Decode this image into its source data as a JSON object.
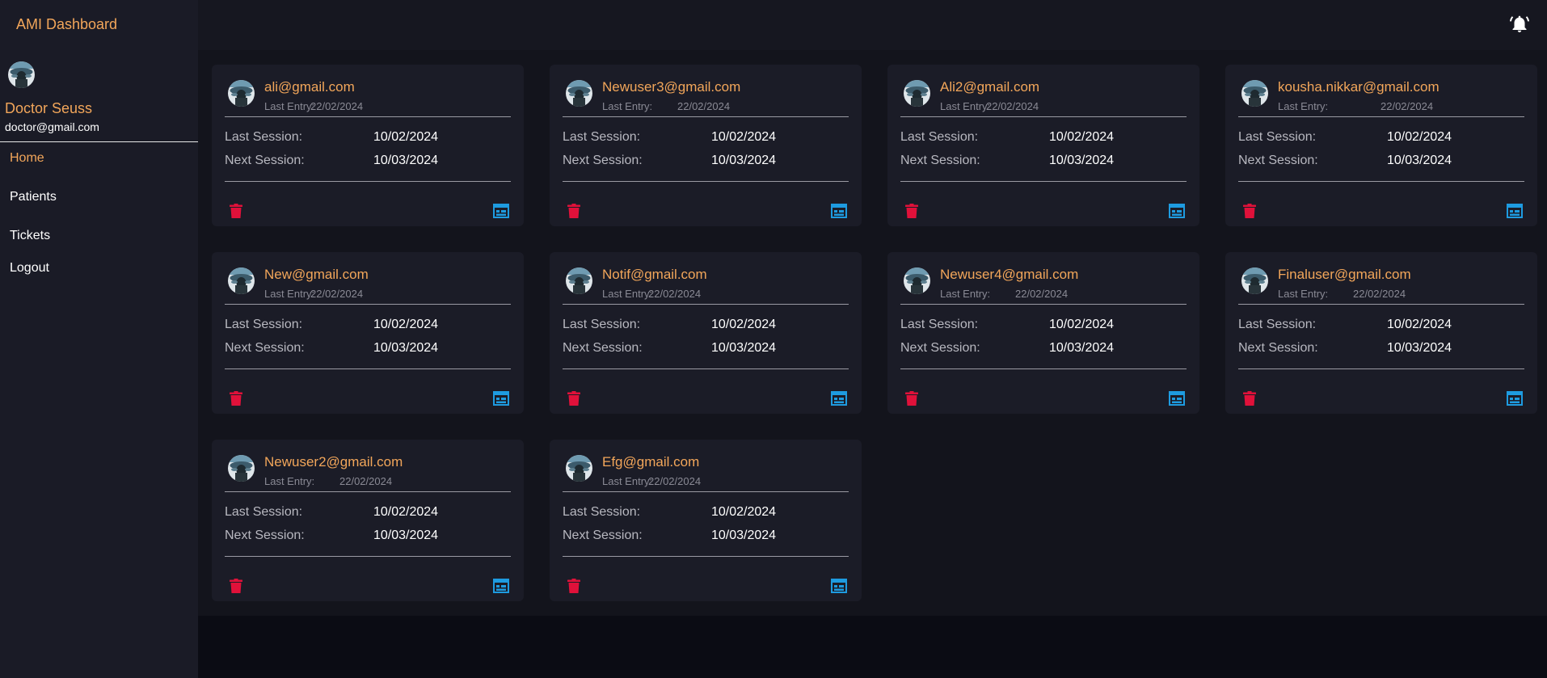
{
  "app": {
    "title": "AMI Dashboard"
  },
  "doctor": {
    "name": "Doctor Seuss",
    "email": "doctor@gmail.com"
  },
  "nav": [
    {
      "label": "Home",
      "active": true
    },
    {
      "label": "Patients",
      "active": false
    },
    {
      "label": "Tickets",
      "active": false
    },
    {
      "label": "Logout",
      "active": false
    }
  ],
  "colors": {
    "accent": "#f2a65a",
    "delete": "#e0113a",
    "calendar": "#1e9be0"
  },
  "icons": {
    "notifications": "bell-icon",
    "delete": "trash-icon",
    "calendar": "calendar-icon"
  },
  "labels": {
    "last_entry": "Last Entry:",
    "last_session": "Last Session:",
    "next_session": "Next Session:"
  },
  "patients": [
    {
      "email": "ali@gmail.com",
      "last_entry": "22/02/2024",
      "last_session": "10/02/2024",
      "next_session": "10/03/2024"
    },
    {
      "email": "Newuser3@gmail.com",
      "last_entry": "22/02/2024",
      "last_session": "10/02/2024",
      "next_session": "10/03/2024"
    },
    {
      "email": "Ali2@gmail.com",
      "last_entry": "22/02/2024",
      "last_session": "10/02/2024",
      "next_session": "10/03/2024"
    },
    {
      "email": "kousha.nikkar@gmail.com",
      "last_entry": "22/02/2024",
      "last_session": "10/02/2024",
      "next_session": "10/03/2024"
    },
    {
      "email": "New@gmail.com",
      "last_entry": "22/02/2024",
      "last_session": "10/02/2024",
      "next_session": "10/03/2024"
    },
    {
      "email": "Notif@gmail.com",
      "last_entry": "22/02/2024",
      "last_session": "10/02/2024",
      "next_session": "10/03/2024"
    },
    {
      "email": "Newuser4@gmail.com",
      "last_entry": "22/02/2024",
      "last_session": "10/02/2024",
      "next_session": "10/03/2024"
    },
    {
      "email": "Finaluser@gmail.com",
      "last_entry": "22/02/2024",
      "last_session": "10/02/2024",
      "next_session": "10/03/2024"
    },
    {
      "email": "Newuser2@gmail.com",
      "last_entry": "22/02/2024",
      "last_session": "10/02/2024",
      "next_session": "10/03/2024"
    },
    {
      "email": "Efg@gmail.com",
      "last_entry": "22/02/2024",
      "last_session": "10/02/2024",
      "next_session": "10/03/2024"
    }
  ]
}
